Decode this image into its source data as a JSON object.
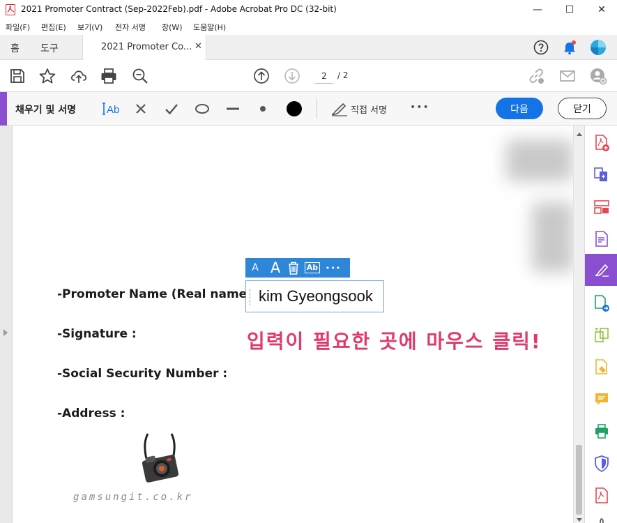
{
  "window": {
    "title": "2021 Promoter Contract (Sep-2022Feb).pdf - Adobe Acrobat Pro DC (32-bit)",
    "minimize": "—",
    "maximize": "☐",
    "close": "✕"
  },
  "menu": [
    "파일(F)",
    "편집(E)",
    "보기(V)",
    "전자 서명",
    "창(W)",
    "도움말(H)"
  ],
  "tabs": {
    "home": "홈",
    "tools": "도구",
    "document": "2021 Promoter Co...",
    "close_glyph": "✕"
  },
  "toolbar": {
    "current_page": "2",
    "total_pages": "/ 2"
  },
  "fill_sign": {
    "title": "채우기 및 서명",
    "sign_label": "직접 서명",
    "more": "•••",
    "next_button": "다음",
    "close_button": "닫기"
  },
  "field_toolbar": {
    "small_a": "A",
    "large_a": "A",
    "ab": "Ab",
    "more": "•••"
  },
  "document": {
    "labels": [
      "-Promoter Name (Real name) :",
      "-Signature   :",
      "-Social Security Number :",
      "-Address :"
    ],
    "name_value": "kim Gyeongsook",
    "hint": "입력이 필요한 곳에 마우스 클릭!",
    "watermark": "gamsungit.co.kr"
  },
  "colors": {
    "accent_purple": "#8a4fd0",
    "primary_blue": "#1473e6",
    "hint_pink": "#e03a6c"
  }
}
